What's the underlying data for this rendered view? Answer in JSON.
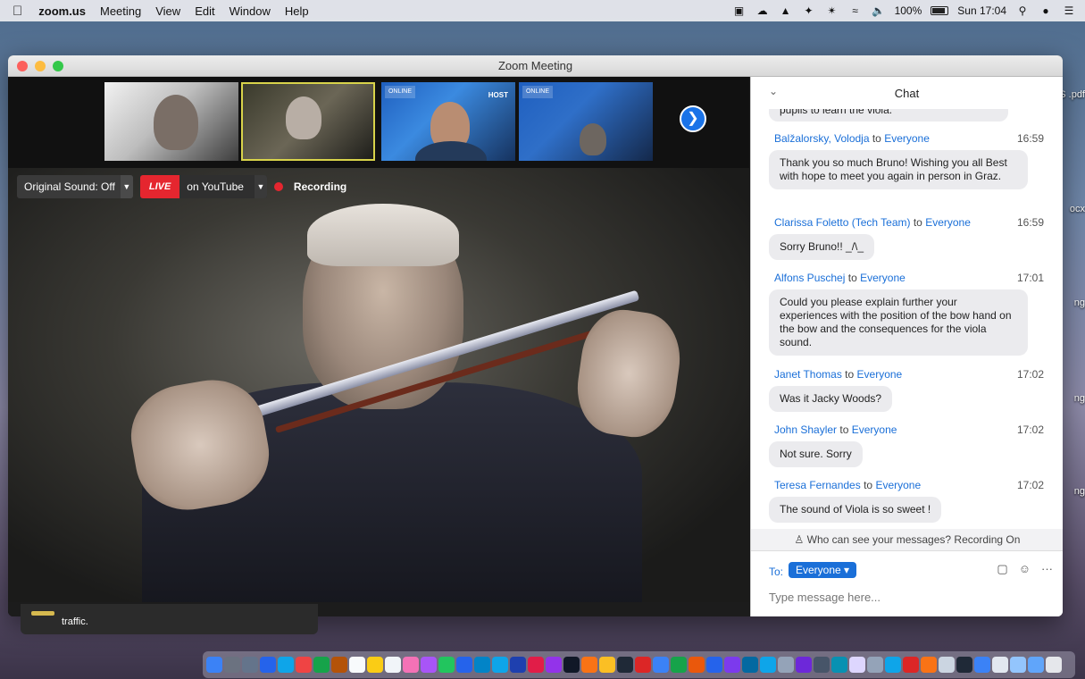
{
  "menubar": {
    "app_name": "zoom.us",
    "items": [
      "Meeting",
      "View",
      "Edit",
      "Window",
      "Help"
    ],
    "battery": "100%",
    "clock": "Sun 17:04"
  },
  "desktop": {
    "files": [
      "_ES\n.pdf",
      "ocx",
      "ng",
      "ng",
      "ng"
    ]
  },
  "window": {
    "title": "Zoom Meeting"
  },
  "thumbnails": [
    {
      "name": "participant-1"
    },
    {
      "name": "participant-2"
    },
    {
      "name": "participant-3",
      "badge": "ONLINE",
      "label": "HOST"
    },
    {
      "name": "participant-4",
      "badge": "ONLINE"
    }
  ],
  "controls": {
    "original_sound": "Original Sound: Off",
    "live": "LIVE",
    "live_target": "on YouTube",
    "recording": "Recording"
  },
  "chat": {
    "title": "Chat",
    "cut_message": "pupils to learn the viola.",
    "messages": [
      {
        "sender": "Balžalorsky, Volodja",
        "to": "to",
        "recipient": "Everyone",
        "time": "16:59",
        "text": "Thank you so much Bruno! Wishing you all Best with hope to meet you again in person in Graz."
      },
      {
        "sender": "Clarissa Foletto (Tech Team)",
        "to": "to",
        "recipient": "Everyone",
        "time": "16:59",
        "text": "Sorry Bruno!! _/\\_"
      },
      {
        "sender": "Alfons Puschej",
        "to": "to",
        "recipient": "Everyone",
        "time": "17:01",
        "text": "Could you please explain further your experiences with the position of the bow hand on the bow and the consequences for the viola sound."
      },
      {
        "sender": "Janet Thomas",
        "to": "to",
        "recipient": "Everyone",
        "time": "17:02",
        "text": "Was it Jacky Woods?"
      },
      {
        "sender": "John Shayler",
        "to": "to",
        "recipient": "Everyone",
        "time": "17:02",
        "text": "Not sure. Sorry"
      },
      {
        "sender": "Teresa Fernandes",
        "to": "to",
        "recipient": "Everyone",
        "time": "17:02",
        "text": "The sound of Viola is so sweet !"
      }
    ],
    "privacy": "Who can see your messages? Recording On",
    "to_label": "To:",
    "to_value": "Everyone ▾",
    "placeholder": "Type message here..."
  },
  "notification": {
    "text": "traffic."
  },
  "colors": {
    "accent": "#1a73e8",
    "live_red": "#e5262f",
    "speaker_highlight": "#d8d34a"
  }
}
